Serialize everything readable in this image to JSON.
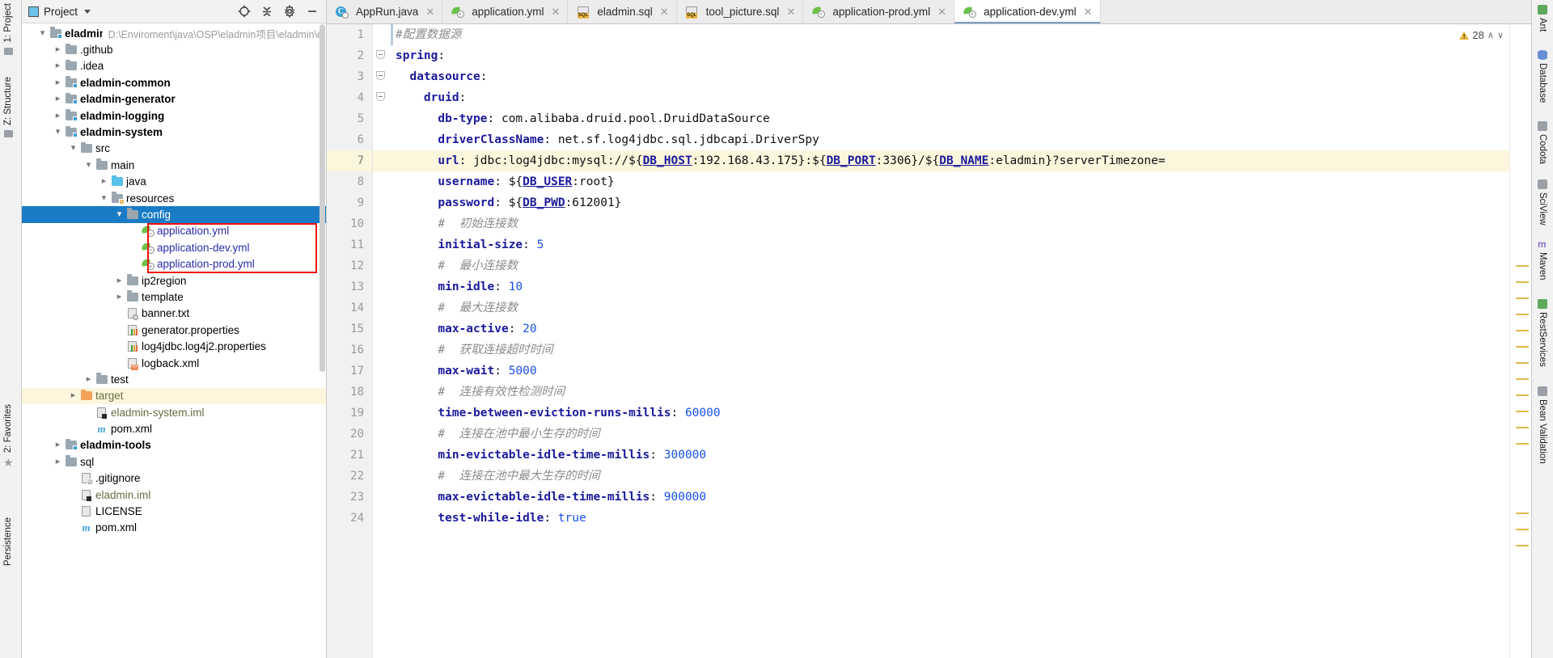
{
  "left_rail": {
    "items": [
      {
        "label": "1: Project",
        "icon": "project-icon"
      },
      {
        "label": "Z: Structure",
        "icon": "structure-icon"
      },
      {
        "label": "2: Favorites",
        "icon": "star-icon"
      },
      {
        "label": "Persistence",
        "icon": "persistence-icon"
      }
    ]
  },
  "project_panel": {
    "title": "Project",
    "toolbar": [
      {
        "name": "locate-icon",
        "glyph": "⊕"
      },
      {
        "name": "collapse-all-icon",
        "glyph": "≡"
      },
      {
        "name": "settings-gear-icon",
        "glyph": "⚙"
      },
      {
        "name": "hide-icon",
        "glyph": "—"
      }
    ],
    "tree": [
      {
        "indent": 0,
        "arrow": "down",
        "icon": "module-folder-icon",
        "label": "eladmin",
        "bold": true,
        "note": "D:\\Enviroment\\java\\OSP\\eladmin项目\\eladmin\\e"
      },
      {
        "indent": 1,
        "arrow": "right",
        "icon": "folder-icon",
        "label": ".github"
      },
      {
        "indent": 1,
        "arrow": "right",
        "icon": "folder-icon",
        "label": ".idea"
      },
      {
        "indent": 1,
        "arrow": "right",
        "icon": "module-folder-icon",
        "label": "eladmin-common",
        "bold": true
      },
      {
        "indent": 1,
        "arrow": "right",
        "icon": "module-folder-icon",
        "label": "eladmin-generator",
        "bold": true
      },
      {
        "indent": 1,
        "arrow": "right",
        "icon": "module-folder-icon",
        "label": "eladmin-logging",
        "bold": true
      },
      {
        "indent": 1,
        "arrow": "down",
        "icon": "module-folder-icon",
        "label": "eladmin-system",
        "bold": true
      },
      {
        "indent": 2,
        "arrow": "down",
        "icon": "folder-icon",
        "label": "src"
      },
      {
        "indent": 3,
        "arrow": "down",
        "icon": "folder-icon",
        "label": "main"
      },
      {
        "indent": 4,
        "arrow": "right",
        "icon": "source-folder-icon",
        "label": "java"
      },
      {
        "indent": 4,
        "arrow": "down",
        "icon": "resources-folder-icon",
        "label": "resources"
      },
      {
        "indent": 5,
        "arrow": "down",
        "icon": "folder-icon",
        "label": "config",
        "selected": true
      },
      {
        "indent": 6,
        "arrow": "none",
        "icon": "yml-file-icon",
        "label": "application.yml",
        "color": "blue"
      },
      {
        "indent": 6,
        "arrow": "none",
        "icon": "yml-file-icon",
        "label": "application-dev.yml",
        "color": "blue"
      },
      {
        "indent": 6,
        "arrow": "none",
        "icon": "yml-file-icon",
        "label": "application-prod.yml",
        "color": "blue"
      },
      {
        "indent": 5,
        "arrow": "right",
        "icon": "folder-icon",
        "label": "ip2region"
      },
      {
        "indent": 5,
        "arrow": "right",
        "icon": "folder-icon",
        "label": "template"
      },
      {
        "indent": 5,
        "arrow": "none",
        "icon": "txt-file-icon",
        "label": "banner.txt"
      },
      {
        "indent": 5,
        "arrow": "none",
        "icon": "properties-file-icon",
        "label": "generator.properties"
      },
      {
        "indent": 5,
        "arrow": "none",
        "icon": "properties-file-icon",
        "label": "log4jdbc.log4j2.properties"
      },
      {
        "indent": 5,
        "arrow": "none",
        "icon": "xml-file-icon",
        "label": "logback.xml"
      },
      {
        "indent": 3,
        "arrow": "right",
        "icon": "folder-icon",
        "label": "test"
      },
      {
        "indent": 2,
        "arrow": "right",
        "icon": "target-folder-icon",
        "label": "target",
        "color": "olive",
        "highlight": true
      },
      {
        "indent": 3,
        "arrow": "none",
        "icon": "iml-file-icon",
        "label": "eladmin-system.iml",
        "color": "olive"
      },
      {
        "indent": 3,
        "arrow": "none",
        "icon": "maven-file-icon",
        "label": "pom.xml"
      },
      {
        "indent": 1,
        "arrow": "right",
        "icon": "module-folder-icon",
        "label": "eladmin-tools",
        "bold": true
      },
      {
        "indent": 1,
        "arrow": "right",
        "icon": "folder-icon",
        "label": "sql"
      },
      {
        "indent": 2,
        "arrow": "none",
        "icon": "gitignore-file-icon",
        "label": ".gitignore"
      },
      {
        "indent": 2,
        "arrow": "none",
        "icon": "iml-file-icon",
        "label": "eladmin.iml",
        "color": "olive"
      },
      {
        "indent": 2,
        "arrow": "none",
        "icon": "license-file-icon",
        "label": "LICENSE"
      },
      {
        "indent": 2,
        "arrow": "none",
        "icon": "maven-file-icon",
        "label": "pom.xml"
      }
    ]
  },
  "editor": {
    "tabs": [
      {
        "label": "AppRun.java",
        "icon": "java-run-icon",
        "active": false
      },
      {
        "label": "application.yml",
        "icon": "yml-file-icon",
        "active": false
      },
      {
        "label": "eladmin.sql",
        "icon": "sql-file-icon",
        "active": false
      },
      {
        "label": "tool_picture.sql",
        "icon": "sql-file-icon",
        "active": false
      },
      {
        "label": "application-prod.yml",
        "icon": "yml-file-icon",
        "active": false
      },
      {
        "label": "application-dev.yml",
        "icon": "yml-file-icon",
        "active": true
      }
    ],
    "inspection": {
      "count": "28",
      "up_glyph": "∧",
      "down_glyph": "∨"
    },
    "current_line": 7,
    "lines": [
      {
        "n": 1,
        "indent": 0,
        "fold": "none",
        "tokens": [
          {
            "t": "cmt",
            "s": "#配置数据源"
          }
        ]
      },
      {
        "n": 2,
        "indent": 0,
        "fold": "start",
        "tokens": [
          {
            "t": "k",
            "s": "spring"
          },
          {
            "t": "plain",
            "s": ":"
          }
        ]
      },
      {
        "n": 3,
        "indent": 1,
        "fold": "start",
        "tokens": [
          {
            "t": "k",
            "s": "datasource"
          },
          {
            "t": "plain",
            "s": ":"
          }
        ]
      },
      {
        "n": 4,
        "indent": 2,
        "fold": "start",
        "tokens": [
          {
            "t": "k",
            "s": "druid"
          },
          {
            "t": "plain",
            "s": ":"
          }
        ]
      },
      {
        "n": 5,
        "indent": 3,
        "fold": "none",
        "tokens": [
          {
            "t": "k",
            "s": "db-type"
          },
          {
            "t": "plain",
            "s": ": "
          },
          {
            "t": "val",
            "s": "com.alibaba.druid.pool.DruidDataSource"
          }
        ]
      },
      {
        "n": 6,
        "indent": 3,
        "fold": "none",
        "tokens": [
          {
            "t": "k",
            "s": "driverClassName"
          },
          {
            "t": "plain",
            "s": ": "
          },
          {
            "t": "val",
            "s": "net.sf.log4jdbc.sql.jdbcapi.DriverSpy"
          }
        ]
      },
      {
        "n": 7,
        "indent": 3,
        "fold": "none",
        "highlight": true,
        "tokens": [
          {
            "t": "k",
            "s": "url"
          },
          {
            "t": "plain",
            "s": ": "
          },
          {
            "t": "val",
            "s": "jdbc:log4jdbc:mysql://${"
          },
          {
            "t": "macro",
            "s": "DB_HOST"
          },
          {
            "t": "val",
            "s": ":192.168.43.175}:${"
          },
          {
            "t": "macro",
            "s": "DB_PORT"
          },
          {
            "t": "val",
            "s": ":3306}/${"
          },
          {
            "t": "macro",
            "s": "DB_NAME"
          },
          {
            "t": "val",
            "s": ":eladmin}?serverTimezone="
          }
        ]
      },
      {
        "n": 8,
        "indent": 3,
        "fold": "none",
        "tokens": [
          {
            "t": "k",
            "s": "username"
          },
          {
            "t": "plain",
            "s": ": "
          },
          {
            "t": "val",
            "s": "${"
          },
          {
            "t": "macro",
            "s": "DB_USER"
          },
          {
            "t": "val",
            "s": ":root}"
          }
        ]
      },
      {
        "n": 9,
        "indent": 3,
        "fold": "none",
        "tokens": [
          {
            "t": "k",
            "s": "password"
          },
          {
            "t": "plain",
            "s": ": "
          },
          {
            "t": "val",
            "s": "${"
          },
          {
            "t": "macro",
            "s": "DB_PWD"
          },
          {
            "t": "val",
            "s": ":612001}"
          }
        ]
      },
      {
        "n": 10,
        "indent": 3,
        "fold": "none",
        "tokens": [
          {
            "t": "cmt",
            "s": "#  初始连接数"
          }
        ]
      },
      {
        "n": 11,
        "indent": 3,
        "fold": "none",
        "tokens": [
          {
            "t": "k",
            "s": "initial-size"
          },
          {
            "t": "plain",
            "s": ": "
          },
          {
            "t": "num",
            "s": "5"
          }
        ]
      },
      {
        "n": 12,
        "indent": 3,
        "fold": "none",
        "tokens": [
          {
            "t": "cmt",
            "s": "#  最小连接数"
          }
        ]
      },
      {
        "n": 13,
        "indent": 3,
        "fold": "none",
        "tokens": [
          {
            "t": "k",
            "s": "min-idle"
          },
          {
            "t": "plain",
            "s": ": "
          },
          {
            "t": "num",
            "s": "10"
          }
        ]
      },
      {
        "n": 14,
        "indent": 3,
        "fold": "none",
        "tokens": [
          {
            "t": "cmt",
            "s": "#  最大连接数"
          }
        ]
      },
      {
        "n": 15,
        "indent": 3,
        "fold": "none",
        "tokens": [
          {
            "t": "k",
            "s": "max-active"
          },
          {
            "t": "plain",
            "s": ": "
          },
          {
            "t": "num",
            "s": "20"
          }
        ]
      },
      {
        "n": 16,
        "indent": 3,
        "fold": "none",
        "tokens": [
          {
            "t": "cmt",
            "s": "#  获取连接超时时间"
          }
        ]
      },
      {
        "n": 17,
        "indent": 3,
        "fold": "none",
        "tokens": [
          {
            "t": "k",
            "s": "max-wait"
          },
          {
            "t": "plain",
            "s": ": "
          },
          {
            "t": "num",
            "s": "5000"
          }
        ]
      },
      {
        "n": 18,
        "indent": 3,
        "fold": "none",
        "tokens": [
          {
            "t": "cmt",
            "s": "#  连接有效性检测时间"
          }
        ]
      },
      {
        "n": 19,
        "indent": 3,
        "fold": "none",
        "tokens": [
          {
            "t": "k",
            "s": "time-between-eviction-runs-millis"
          },
          {
            "t": "plain",
            "s": ": "
          },
          {
            "t": "num",
            "s": "60000"
          }
        ]
      },
      {
        "n": 20,
        "indent": 3,
        "fold": "none",
        "tokens": [
          {
            "t": "cmt",
            "s": "#  连接在池中最小生存的时间"
          }
        ]
      },
      {
        "n": 21,
        "indent": 3,
        "fold": "none",
        "tokens": [
          {
            "t": "k",
            "s": "min-evictable-idle-time-millis"
          },
          {
            "t": "plain",
            "s": ": "
          },
          {
            "t": "num",
            "s": "300000"
          }
        ]
      },
      {
        "n": 22,
        "indent": 3,
        "fold": "none",
        "tokens": [
          {
            "t": "cmt",
            "s": "#  连接在池中最大生存的时间"
          }
        ]
      },
      {
        "n": 23,
        "indent": 3,
        "fold": "none",
        "tokens": [
          {
            "t": "k",
            "s": "max-evictable-idle-time-millis"
          },
          {
            "t": "plain",
            "s": ": "
          },
          {
            "t": "num",
            "s": "900000"
          }
        ]
      },
      {
        "n": 24,
        "indent": 3,
        "fold": "none",
        "tokens": [
          {
            "t": "k",
            "s": "test-while-idle"
          },
          {
            "t": "plain",
            "s": ": "
          },
          {
            "t": "num",
            "s": "true"
          }
        ]
      }
    ]
  },
  "right_rail": {
    "items": [
      {
        "label": "Ant",
        "icon": "ant-icon"
      },
      {
        "label": "Database",
        "icon": "database-icon"
      },
      {
        "label": "Codota",
        "icon": "codota-icon"
      },
      {
        "label": "SciView",
        "icon": "sciview-icon"
      },
      {
        "label": "Maven",
        "icon": "maven-icon"
      },
      {
        "label": "RestServices",
        "icon": "rest-services-icon"
      },
      {
        "label": "Bean Validation",
        "icon": "bean-validation-icon"
      }
    ]
  },
  "colors": {
    "selection_blue": "#1a7cc6",
    "annotation_red": "#ee1111",
    "current_line_yellow": "#fcf6dc",
    "target_row_yellow": "#fdf6dd",
    "keyword_blue": "#1a1a9c",
    "number_blue": "#1750eb",
    "comment_grey": "#8c8c8c"
  }
}
